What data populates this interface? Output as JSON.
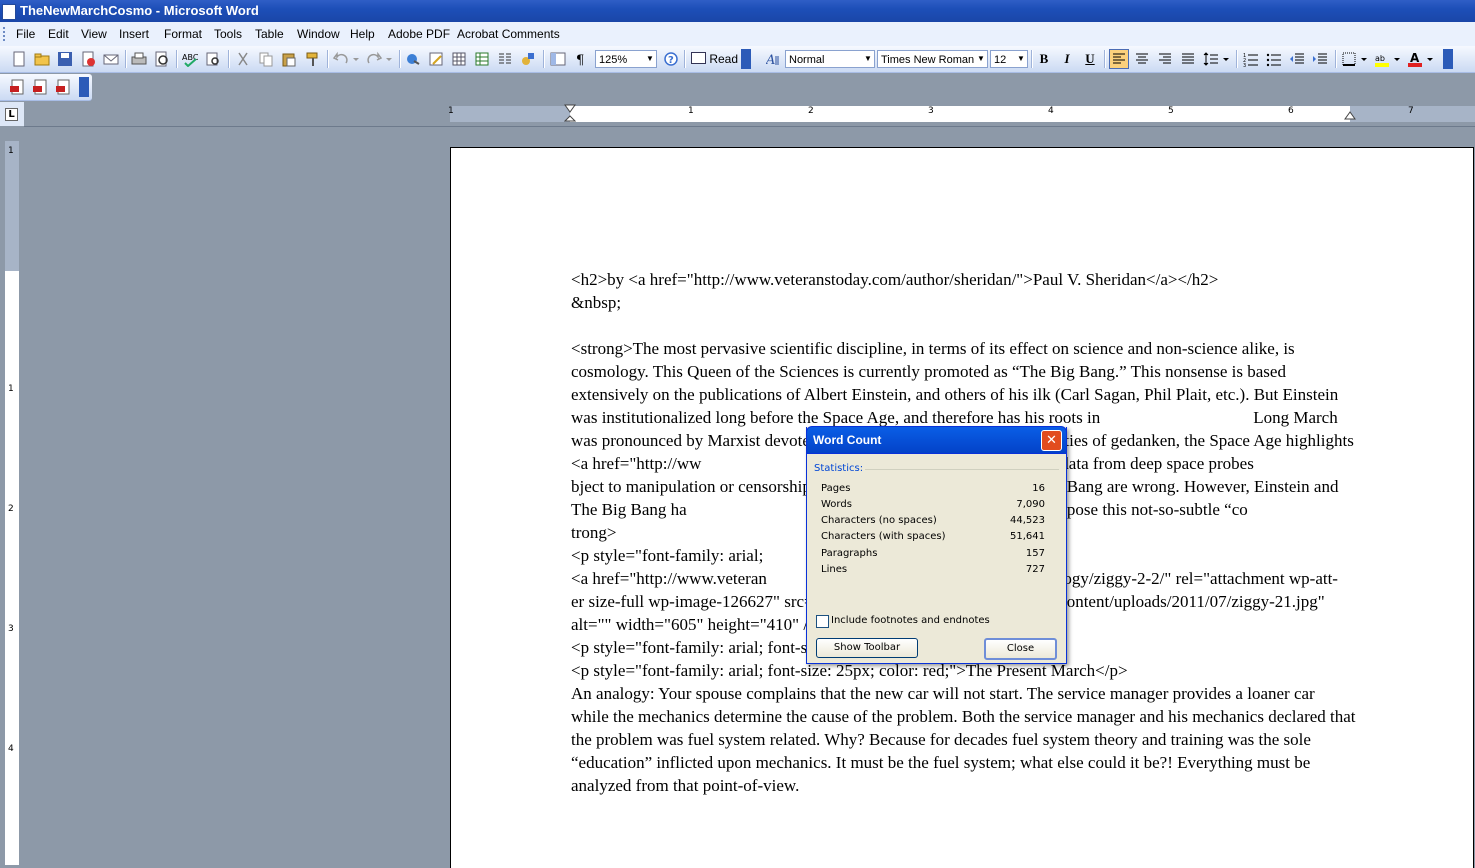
{
  "window": {
    "title": "TheNewMarchCosmo - Microsoft Word"
  },
  "menu": [
    "File",
    "Edit",
    "View",
    "Insert",
    "Format",
    "Tools",
    "Table",
    "Window",
    "Help",
    "Adobe PDF",
    "Acrobat Comments"
  ],
  "toolbar": {
    "zoom": "125%",
    "read_label": "Read",
    "style": "Normal",
    "font": "Times New Roman",
    "font_size": "12",
    "bold": "B",
    "italic": "I",
    "underline": "U"
  },
  "ruler": {
    "h_numbers": [
      "1",
      "1",
      "2",
      "3",
      "4",
      "5",
      "6",
      "7"
    ],
    "v_numbers": [
      "1",
      "1",
      "2",
      "3",
      "4"
    ]
  },
  "document": {
    "text": "<h2>by <a href=\"http://www.veteranstoday.com/author/sheridan/\">Paul V. Sheridan</a></h2>\n&nbsp;\n\n<strong>The most pervasive scientific discipline, in terms of its effect on science and non-science alike, is cosmology. This Queen of the Sciences is currently promoted as “The Big Bang.” This nonsense is based extensively on the publications of Albert Einstein, and others of his ilk (Carl Sagan, Phil Plait, etc.). But Einstein was institutionalized long before the Space Age, and therefore has his roots in                                    Long March was pronounced by Marxist devotee Antonio Gra                                 inities of gedanken, the Space Age highlights <a href=\"http://ww                              0mKLsuo\" target=\"_blank\">hard data from deep space probes                              bject to manipulation or censorship) overwhelming ev                              Bang are wrong. However, Einstein and The Big Bang ha                              ithin The Long March. It’s time to expose this not-so-subtle “co                              trong>\n<p style=\"font-family: arial;                                 </p>\n<a href=\"http://www.veteran                              -march-to-a-new-cosmology/ziggy-2-2/\" rel=\"attachment wp-att-                              er size-full wp-image-126627\" src=\"http://www.veteranstoday.com/wp-content/uploads/2011/07/ziggy-21.jpg\" alt=\"\" width=\"605\" height=\"410\" /></a>\n<p style=\"font-family: arial; font-size: 15px; color: white;\"></p>\n<p style=\"font-family: arial; font-size: 25px; color: red;\">The Present March</p>\nAn analogy: Your spouse complains that the new car will not start. The service manager provides a loaner car while the mechanics determine the cause of the problem. Both the service manager and his mechanics declared that the problem was fuel system related. Why? Because for decades fuel system theory and training was the sole “education” inflicted upon mechanics. It must be the fuel system; what else could it be?! Everything must be analyzed from that point-of-view."
  },
  "dialog": {
    "title": "Word Count",
    "statistics_label": "Statistics:",
    "rows": [
      {
        "label": "Pages",
        "value": "16"
      },
      {
        "label": "Words",
        "value": "7,090"
      },
      {
        "label": "Characters (no spaces)",
        "value": "44,523"
      },
      {
        "label": "Characters (with spaces)",
        "value": "51,641"
      },
      {
        "label": "Paragraphs",
        "value": "157"
      },
      {
        "label": "Lines",
        "value": "727"
      }
    ],
    "checkbox_label": "Include footnotes and endnotes",
    "show_toolbar": "Show Toolbar",
    "close": "Close"
  }
}
